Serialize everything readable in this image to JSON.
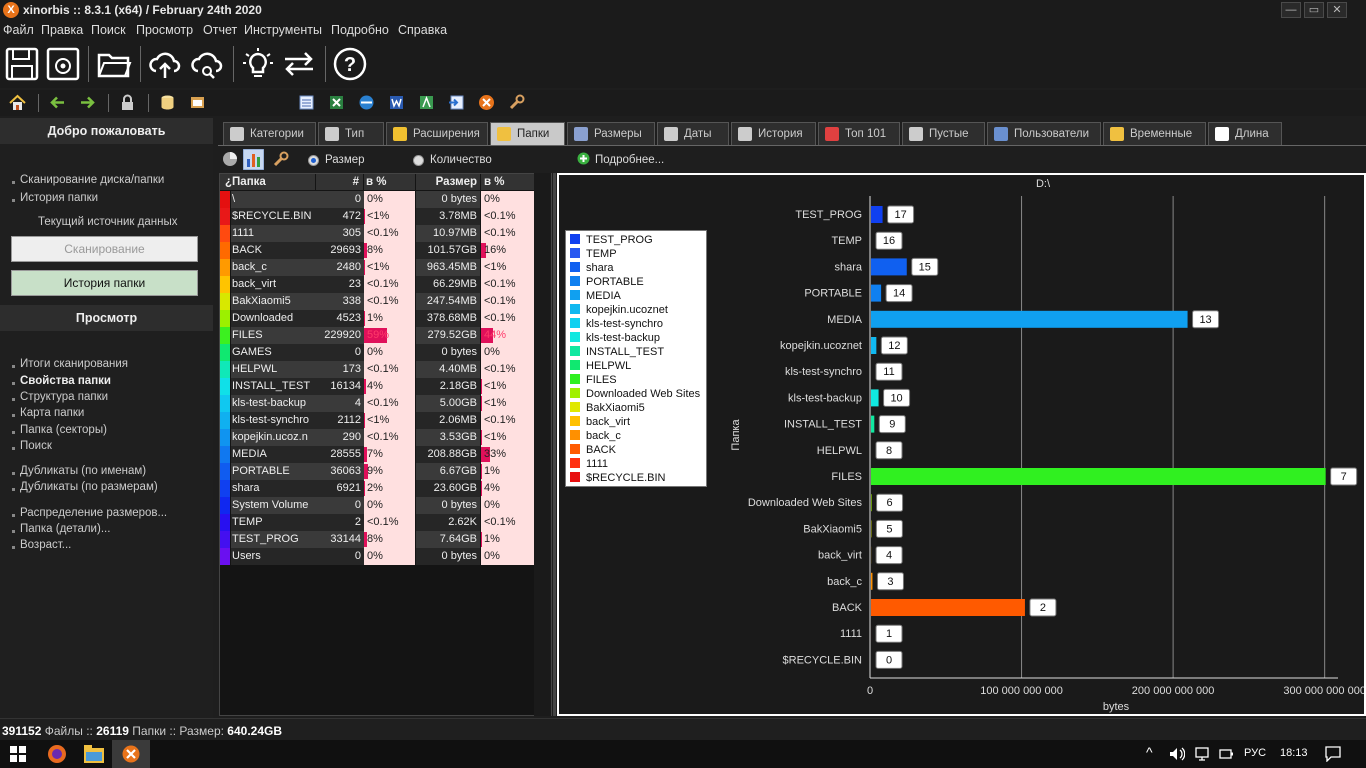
{
  "window": {
    "title": "xinorbis :: 8.3.1 (x64) / February 24th 2020",
    "minimize": "—",
    "maximize": "▭",
    "close": "✕"
  },
  "menu": [
    "Файл",
    "Правка",
    "Поиск",
    "Просмотр",
    "Отчет",
    "Инструменты",
    "Подробно",
    "Справка"
  ],
  "left_panel": {
    "welcome_header": "Добро пожаловать",
    "scan_link": "Сканирование диска/папки",
    "history_link": "История папки",
    "current_source": "Текущий источник данных",
    "scan_button": "Сканирование",
    "history_button": "История папки",
    "view_header": "Просмотр",
    "view_items": [
      {
        "label": "Итоги сканирования",
        "bold": false
      },
      {
        "label": "Свойства папки",
        "bold": true
      },
      {
        "label": "Структура папки",
        "bold": false
      },
      {
        "label": "Карта папки",
        "bold": false
      },
      {
        "label": "Папка (секторы)",
        "bold": false
      },
      {
        "label": "Поиск",
        "bold": false
      },
      {
        "label": "Дубликаты (по именам)",
        "bold": false
      },
      {
        "label": "Дубликаты (по размерам)",
        "bold": false
      },
      {
        "label": "Распределение размеров...",
        "bold": false
      },
      {
        "label": "Папка (детали)...",
        "bold": false
      },
      {
        "label": "Возраст...",
        "bold": false
      }
    ]
  },
  "tabs": [
    {
      "label": "Категории",
      "active": false
    },
    {
      "label": "Тип",
      "active": false
    },
    {
      "label": "Расширения",
      "active": false
    },
    {
      "label": "Папки",
      "active": true
    },
    {
      "label": "Размеры",
      "active": false
    },
    {
      "label": "Даты",
      "active": false
    },
    {
      "label": "История",
      "active": false
    },
    {
      "label": "Топ 101",
      "active": false
    },
    {
      "label": "Пустые",
      "active": false
    },
    {
      "label": "Пользователи",
      "active": false
    },
    {
      "label": "Временные",
      "active": false
    },
    {
      "label": "Длина",
      "active": false
    }
  ],
  "options": {
    "size_label": "Размер",
    "count_label": "Количество",
    "selected": "size",
    "more_label": "Подробнее..."
  },
  "table": {
    "headers": {
      "folder": "Папка",
      "count": "#",
      "count_pct": "в %",
      "size": "Размер",
      "size_pct": "в %"
    },
    "rows": [
      {
        "name": "\\",
        "count": "0",
        "count_pct": "0%",
        "count_pct_val": 0,
        "size": "0 bytes",
        "size_pct": "0%",
        "size_pct_val": 0,
        "color": "#e41010"
      },
      {
        "name": "$RECYCLE.BIN",
        "count": "472",
        "count_pct": "<1%",
        "count_pct_val": 0.2,
        "size": "3.78MB",
        "size_pct": "<0.1%",
        "size_pct_val": 0,
        "color": "#e81818"
      },
      {
        "name": "1111",
        "count": "305",
        "count_pct": "<0.1%",
        "count_pct_val": 0.1,
        "size": "10.97MB",
        "size_pct": "<0.1%",
        "size_pct_val": 0,
        "color": "#ff4a10"
      },
      {
        "name": "BACK",
        "count": "29693",
        "count_pct": "8%",
        "count_pct_val": 8,
        "size": "101.57GB",
        "size_pct": "16%",
        "size_pct_val": 16,
        "color": "#ff6a00"
      },
      {
        "name": "back_c",
        "count": "2480",
        "count_pct": "<1%",
        "count_pct_val": 1,
        "size": "963.45MB",
        "size_pct": "<1%",
        "size_pct_val": 0.2,
        "color": "#ff9a00"
      },
      {
        "name": "back_virt",
        "count": "23",
        "count_pct": "<0.1%",
        "count_pct_val": 0,
        "size": "66.29MB",
        "size_pct": "<0.1%",
        "size_pct_val": 0,
        "color": "#ffc400"
      },
      {
        "name": "BakXiaomi5",
        "count": "338",
        "count_pct": "<0.1%",
        "count_pct_val": 0.1,
        "size": "247.54MB",
        "size_pct": "<0.1%",
        "size_pct_val": 0,
        "color": "#d8e800"
      },
      {
        "name": "Downloaded",
        "count": "4523",
        "count_pct": "1%",
        "count_pct_val": 1,
        "size": "378.68MB",
        "size_pct": "<0.1%",
        "size_pct_val": 0,
        "color": "#9cf000"
      },
      {
        "name": "FILES",
        "count": "229920",
        "count_pct": "59%",
        "count_pct_val": 59,
        "size": "279.52GB",
        "size_pct": "44%",
        "size_pct_val": 44,
        "color": "#3cf020"
      },
      {
        "name": "GAMES",
        "count": "0",
        "count_pct": "0%",
        "count_pct_val": 0,
        "size": "0 bytes",
        "size_pct": "0%",
        "size_pct_val": 0,
        "color": "#10e870"
      },
      {
        "name": "HELPWL",
        "count": "173",
        "count_pct": "<0.1%",
        "count_pct_val": 0,
        "size": "4.40MB",
        "size_pct": "<0.1%",
        "size_pct_val": 0,
        "color": "#10e8b8"
      },
      {
        "name": "INSTALL_TEST",
        "count": "16134",
        "count_pct": "4%",
        "count_pct_val": 4,
        "size": "2.18GB",
        "size_pct": "<1%",
        "size_pct_val": 0.3,
        "color": "#10e0e8"
      },
      {
        "name": "kls-test-backup",
        "count": "4",
        "count_pct": "<0.1%",
        "count_pct_val": 0,
        "size": "5.00GB",
        "size_pct": "<1%",
        "size_pct_val": 0.8,
        "color": "#10c8f0"
      },
      {
        "name": "kls-test-synchro",
        "count": "2112",
        "count_pct": "<1%",
        "count_pct_val": 0.5,
        "size": "2.06MB",
        "size_pct": "<0.1%",
        "size_pct_val": 0,
        "color": "#10b0f0"
      },
      {
        "name": "kopejkin.ucoz.n",
        "count": "290",
        "count_pct": "<0.1%",
        "count_pct_val": 0.1,
        "size": "3.53GB",
        "size_pct": "<1%",
        "size_pct_val": 0.6,
        "color": "#1094f0"
      },
      {
        "name": "MEDIA",
        "count": "28555",
        "count_pct": "7%",
        "count_pct_val": 7,
        "size": "208.88GB",
        "size_pct": "33%",
        "size_pct_val": 33,
        "color": "#1078f0"
      },
      {
        "name": "PORTABLE",
        "count": "36063",
        "count_pct": "9%",
        "count_pct_val": 9,
        "size": "6.67GB",
        "size_pct": "1%",
        "size_pct_val": 1,
        "color": "#105cf0"
      },
      {
        "name": "shara",
        "count": "6921",
        "count_pct": "2%",
        "count_pct_val": 2,
        "size": "23.60GB",
        "size_pct": "4%",
        "size_pct_val": 4,
        "color": "#1040f0"
      },
      {
        "name": "System Volume",
        "count": "0",
        "count_pct": "0%",
        "count_pct_val": 0,
        "size": "0 bytes",
        "size_pct": "0%",
        "size_pct_val": 0,
        "color": "#1028f0"
      },
      {
        "name": "TEMP",
        "count": "2",
        "count_pct": "<0.1%",
        "count_pct_val": 0,
        "size": "2.62K",
        "size_pct": "<0.1%",
        "size_pct_val": 0,
        "color": "#2810f0"
      },
      {
        "name": "TEST_PROG",
        "count": "33144",
        "count_pct": "8%",
        "count_pct_val": 8,
        "size": "7.64GB",
        "size_pct": "1%",
        "size_pct_val": 1,
        "color": "#4410f0"
      },
      {
        "name": "Users",
        "count": "0",
        "count_pct": "0%",
        "count_pct_val": 0,
        "size": "0 bytes",
        "size_pct": "0%",
        "size_pct_val": 0,
        "color": "#6a10f0"
      }
    ]
  },
  "chart_data": {
    "type": "bar",
    "orientation": "horizontal",
    "title": "D:\\",
    "xlabel": "bytes",
    "ylabel": "Папка",
    "xlim": [
      0,
      320000000000
    ],
    "xticks": [
      0,
      100000000000,
      200000000000,
      300000000000
    ],
    "xtick_labels": [
      "0",
      "100 000 000 000",
      "200 000 000 000",
      "300 000 000 000"
    ],
    "grid": true,
    "legend_position": "left",
    "categories": [
      "TEST_PROG",
      "TEMP",
      "shara",
      "PORTABLE",
      "MEDIA",
      "kopejkin.ucoznet",
      "kls-test-synchro",
      "kls-test-backup",
      "INSTALL_TEST",
      "HELPWL",
      "FILES",
      "Downloaded Web Sites",
      "BakXiaomi5",
      "back_virt",
      "back_c",
      "BACK",
      "1111",
      "$RECYCLE.BIN"
    ],
    "values": [
      7640000000,
      2620,
      23600000000,
      6670000000,
      208880000000,
      3530000000,
      2060000,
      5000000000,
      2180000000,
      4400000,
      300000000000,
      378680000,
      247540000,
      66290000,
      963450000,
      101570000000,
      10970000,
      3780000
    ],
    "data_labels": [
      "17",
      "16",
      "15",
      "14",
      "13",
      "12",
      "11",
      "10",
      "9",
      "8",
      "7",
      "6",
      "5",
      "4",
      "3",
      "2",
      "1",
      "0"
    ],
    "colors": [
      "#1040f0",
      "#2858f0",
      "#1060f0",
      "#1080f0",
      "#10a0f0",
      "#10b8f0",
      "#10d0f0",
      "#10e8e0",
      "#10e8a0",
      "#10e870",
      "#30f020",
      "#a0f000",
      "#e0e800",
      "#ffc000",
      "#ff9000",
      "#ff5a00",
      "#ff3010",
      "#e81010"
    ],
    "legend": [
      "TEST_PROG",
      "TEMP",
      "shara",
      "PORTABLE",
      "MEDIA",
      "kopejkin.ucoznet",
      "kls-test-synchro",
      "kls-test-backup",
      "INSTALL_TEST",
      "HELPWL",
      "FILES",
      "Downloaded Web Sites",
      "BakXiaomi5",
      "back_virt",
      "back_c",
      "BACK",
      "1111",
      "$RECYCLE.BIN"
    ]
  },
  "status": {
    "files_count": "391152",
    "files_label": "Файлы",
    "folders_count": "26119",
    "folders_label": "Папки",
    "size_label": "Размер:",
    "size_value": "640.24GB"
  },
  "taskbar": {
    "lang": "РУС",
    "time": "18:13"
  }
}
